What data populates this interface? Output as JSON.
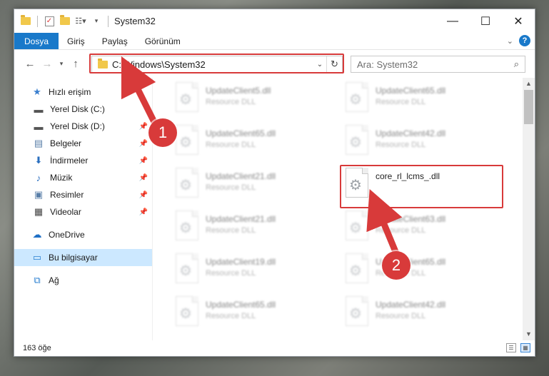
{
  "window": {
    "title": "System32",
    "controls": {
      "minimize": "—",
      "maximize": "☐",
      "close": "✕"
    }
  },
  "ribbon": {
    "tabs": [
      "Dosya",
      "Giriş",
      "Paylaş",
      "Görünüm"
    ],
    "help": "?"
  },
  "nav": {
    "address": "C:\\Windows\\System32",
    "search_placeholder": "Ara: System32"
  },
  "sidebar": {
    "items": [
      {
        "label": "Hızlı erişim",
        "icon": "star-icon",
        "pinned": false
      },
      {
        "label": "Yerel Disk (C:)",
        "icon": "drive-icon",
        "pinned": false
      },
      {
        "label": "Yerel Disk (D:)",
        "icon": "drive-icon",
        "pinned": true
      },
      {
        "label": "Belgeler",
        "icon": "documents-icon",
        "pinned": true
      },
      {
        "label": "İndirmeler",
        "icon": "download-icon",
        "pinned": true
      },
      {
        "label": "Müzik",
        "icon": "music-icon",
        "pinned": true
      },
      {
        "label": "Resimler",
        "icon": "pictures-icon",
        "pinned": true
      },
      {
        "label": "Videolar",
        "icon": "videos-icon",
        "pinned": true
      },
      {
        "label": "OneDrive",
        "icon": "cloud-icon",
        "pinned": false
      },
      {
        "label": "Bu bilgisayar",
        "icon": "computer-icon",
        "pinned": false
      },
      {
        "label": "Ağ",
        "icon": "network-icon",
        "pinned": false
      }
    ]
  },
  "files": [
    {
      "name": "UpdateClient5.dll",
      "type": "Resource DLL"
    },
    {
      "name": "UpdateClient65.dll",
      "type": "Resource DLL"
    },
    {
      "name": "UpdateClient65.dll",
      "type": "Resource DLL"
    },
    {
      "name": "UpdateClient42.dll",
      "type": "Resource DLL"
    },
    {
      "name": "UpdateClient21.dll",
      "type": "Resource DLL"
    },
    {
      "name": "core_rl_lcms_.dll",
      "type": ""
    },
    {
      "name": "UpdateClient21.dll",
      "type": "Resource DLL"
    },
    {
      "name": "UpdateClient63.dll",
      "type": "Resource DLL"
    },
    {
      "name": "UpdateClient19.dll",
      "type": "Resource DLL"
    },
    {
      "name": "UpdateClient65.dll",
      "type": "Resource DLL"
    },
    {
      "name": "UpdateClient65.dll",
      "type": "Resource DLL"
    },
    {
      "name": "UpdateClient42.dll",
      "type": "Resource DLL"
    }
  ],
  "status": {
    "count": "163 öğe"
  },
  "annotations": {
    "step1": "1",
    "step2": "2"
  },
  "colors": {
    "accent": "#1979ca",
    "annotation": "#d83a3a",
    "selected": "#cce8ff"
  }
}
